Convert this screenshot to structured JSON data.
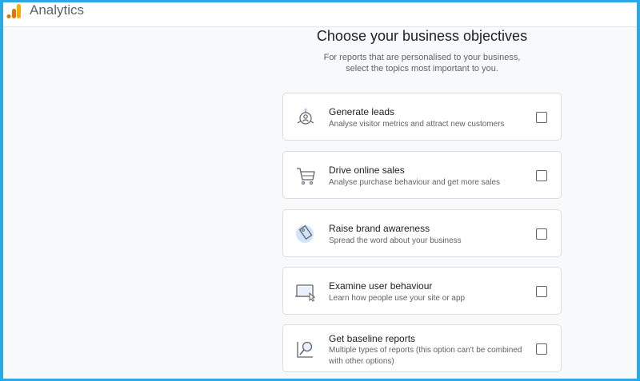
{
  "header": {
    "app_name": "Analytics",
    "logo_icon": "analytics-logo-icon",
    "logo_colors": [
      "#f9ab00",
      "#e37400"
    ]
  },
  "main": {
    "title": "Choose your business objectives",
    "subtitle_line1": "For reports that are personalised to your business,",
    "subtitle_line2": "select the topics most important to you."
  },
  "objectives": [
    {
      "icon": "leads-target-icon",
      "title": "Generate leads",
      "description": "Analyse visitor metrics and attract new customers",
      "checked": false
    },
    {
      "icon": "shopping-cart-icon",
      "title": "Drive online sales",
      "description": "Analyse purchase behaviour and get more sales",
      "checked": false
    },
    {
      "icon": "price-tag-icon",
      "title": "Raise brand awareness",
      "description": "Spread the word about your business",
      "checked": false
    },
    {
      "icon": "screen-cursor-icon",
      "title": "Examine user behaviour",
      "description": "Learn how people use your site or app",
      "checked": false
    },
    {
      "icon": "magnifier-report-icon",
      "title": "Get baseline reports",
      "description": "Multiple types of reports (this option can't be combined with other options)",
      "checked": false
    }
  ]
}
